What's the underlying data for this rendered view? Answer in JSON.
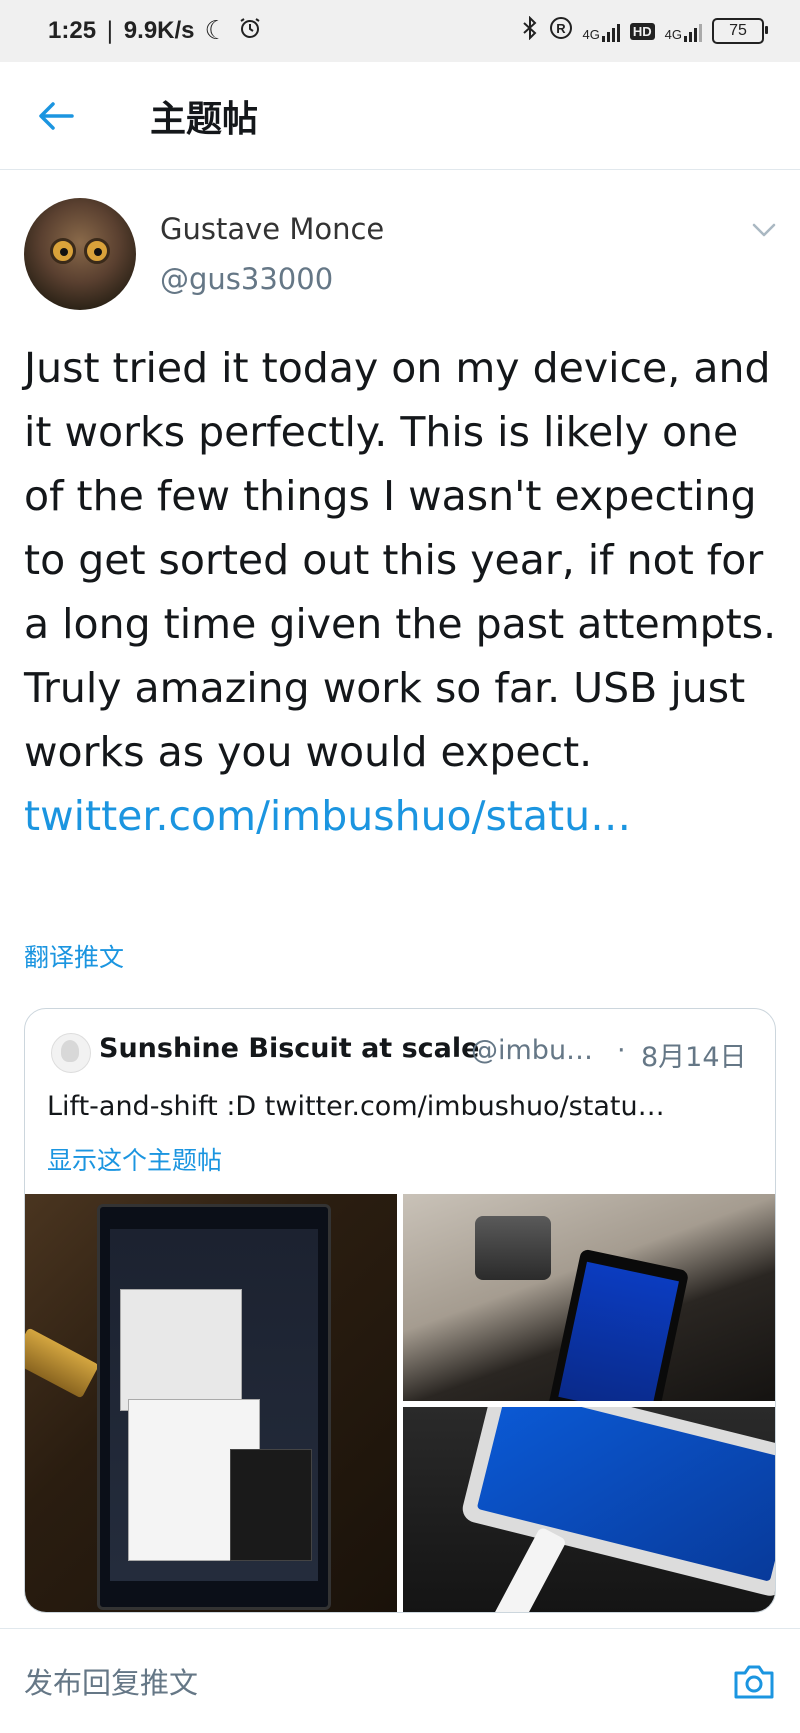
{
  "status_bar": {
    "time": "1:25",
    "speed": "9.9K/s",
    "battery": "75",
    "network_label_1": "4G",
    "network_label_2": "4G",
    "hd_label": "HD"
  },
  "header": {
    "title": "主题帖"
  },
  "tweet": {
    "author_name": "Gustave Monce",
    "author_handle": "@gus33000",
    "text": "Just tried it today on my device, and it works perfectly. This is likely one of the few things I wasn't expecting to get sorted out this year, if not for a long time given the past attempts. Truly amazing work so far. USB just works as you would expect. ",
    "link": "twitter.com/imbushuo/statu…",
    "translate_label": "翻译推文"
  },
  "quoted_tweet": {
    "author_name": "Sunshine Biscuit at scale",
    "author_handle": "@imbu…",
    "separator": "·",
    "date": "8月14日",
    "text": "Lift-and-shift :D twitter.com/imbushuo/statu…",
    "show_thread_label": "显示这个主题帖",
    "images": [
      "phone-desktop-photo",
      "dock-phone-photo",
      "phone-usb-c-photo"
    ]
  },
  "reply": {
    "placeholder": "发布回复推文"
  },
  "icons": {
    "back": "arrow-left-icon",
    "menu": "chevron-down-icon",
    "camera": "camera-icon",
    "accent": "#1b95e0"
  }
}
